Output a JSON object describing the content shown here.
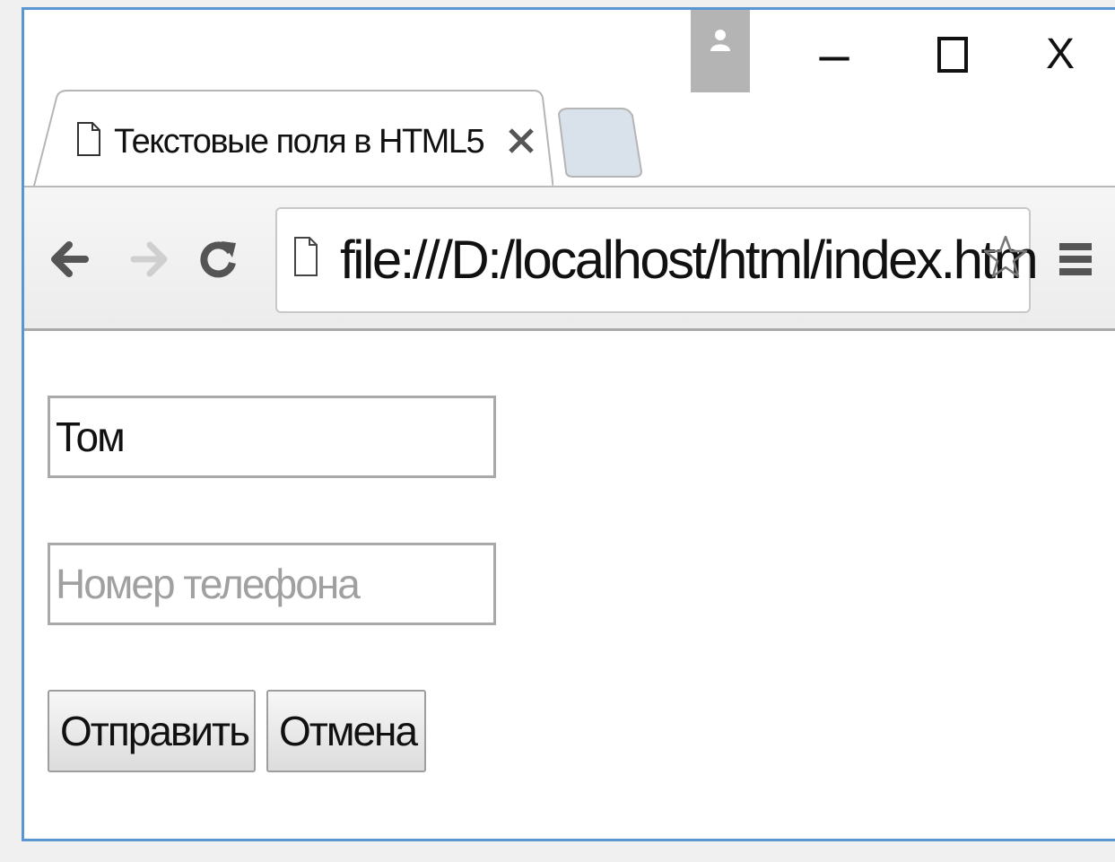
{
  "tab": {
    "title": "Текстовые поля в HTML5",
    "close_glyph": "x"
  },
  "window_controls": {
    "minimize_glyph": "–",
    "close_glyph": "X"
  },
  "address_bar": {
    "url": "file:///D:/localhost/html/index.htm"
  },
  "form": {
    "name_input": {
      "value": "Том",
      "placeholder": ""
    },
    "phone_input": {
      "value": "",
      "placeholder": "Номер телефона"
    },
    "submit_label": "Отправить",
    "cancel_label": "Отмена"
  },
  "colors": {
    "window_border": "#5a96cf",
    "profile_button": "#b4b4b4",
    "input_border": "#a9a9a9",
    "placeholder": "#a0a0a0"
  },
  "icons": {
    "profile": "person-icon",
    "page": "page-icon",
    "back": "arrow-left-icon",
    "forward": "arrow-right-icon",
    "reload": "reload-icon",
    "bookmark": "star-icon",
    "menu": "hamburger-icon"
  }
}
